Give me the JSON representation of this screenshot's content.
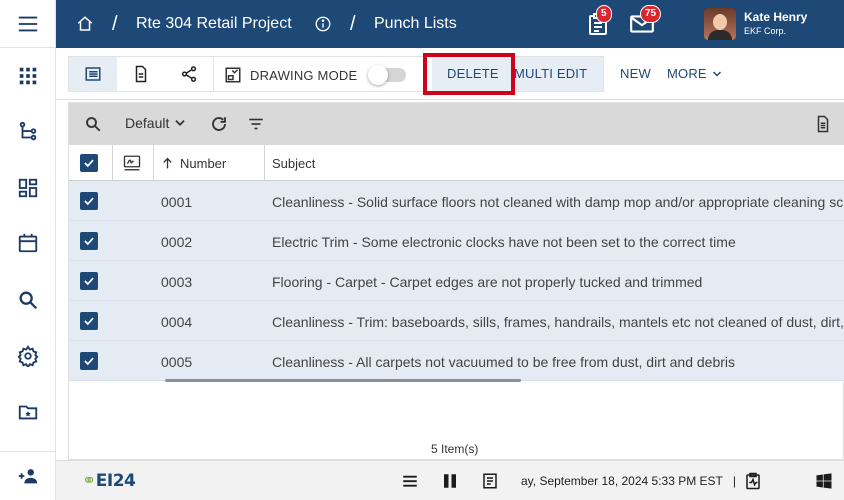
{
  "header": {
    "project": "Rte 304 Retail Project",
    "separator": "/",
    "section": "Punch Lists",
    "tasks_badge": "5",
    "mail_badge": "75",
    "user_name": "Kate Henry",
    "user_org": "EKF Corp."
  },
  "toolbar": {
    "drawing_mode_label": "DRAWING MODE",
    "drawing_mode_on": false,
    "delete_label": "DELETE",
    "multi_edit_label": "MULTI EDIT",
    "new_label": "NEW",
    "more_label": "MORE"
  },
  "grid": {
    "view_label": "Default",
    "columns": [
      "Number",
      "Subject"
    ],
    "rows": [
      {
        "number": "0001",
        "subject": "Cleanliness - Solid surface floors not cleaned with damp mop and/or appropriate cleaning sc",
        "checked": true
      },
      {
        "number": "0002",
        "subject": "Electric Trim - Some electronic clocks have not been set to the correct time",
        "checked": true
      },
      {
        "number": "0003",
        "subject": "Flooring - Carpet - Carpet edges are not properly tucked and trimmed",
        "checked": true
      },
      {
        "number": "0004",
        "subject": "Cleanliness - Trim: baseboards, sills, frames, handrails, mantels etc not cleaned of dust, dirt,",
        "checked": true
      },
      {
        "number": "0005",
        "subject": "Cleanliness - All carpets not vacuumed to be free from dust, dirt and debris",
        "checked": true
      }
    ],
    "item_count": "5 Item(s)"
  },
  "footer": {
    "logo": "EI24",
    "datetime": "ay, September 18, 2024 5:33 PM EST",
    "divider": "|"
  },
  "colors": {
    "header_bg": "#1e4977",
    "accent": "#1e4977",
    "row_selected": "#e4ebf3",
    "highlight_box": "#d0021b",
    "badge": "#d9262f"
  },
  "icons": {
    "sidebar": [
      "menu-icon",
      "apps-grid-icon",
      "workflow-icon",
      "dashboard-icon",
      "calendar-icon",
      "search-icon",
      "settings-icon",
      "starred-folder-icon",
      "add-team-icon"
    ],
    "header": [
      "home-icon",
      "info-icon",
      "tasks-icon",
      "mail-icon"
    ],
    "toolbar": [
      "list-view-icon",
      "document-icon",
      "share-icon",
      "drawing-icon"
    ],
    "grid": [
      "search-icon",
      "refresh-icon",
      "filter-icon",
      "export-icon",
      "signature-icon",
      "sort-asc-icon"
    ],
    "footer": [
      "list-icon",
      "columns-icon",
      "form-icon",
      "checklist-icon",
      "windows-icon"
    ]
  }
}
